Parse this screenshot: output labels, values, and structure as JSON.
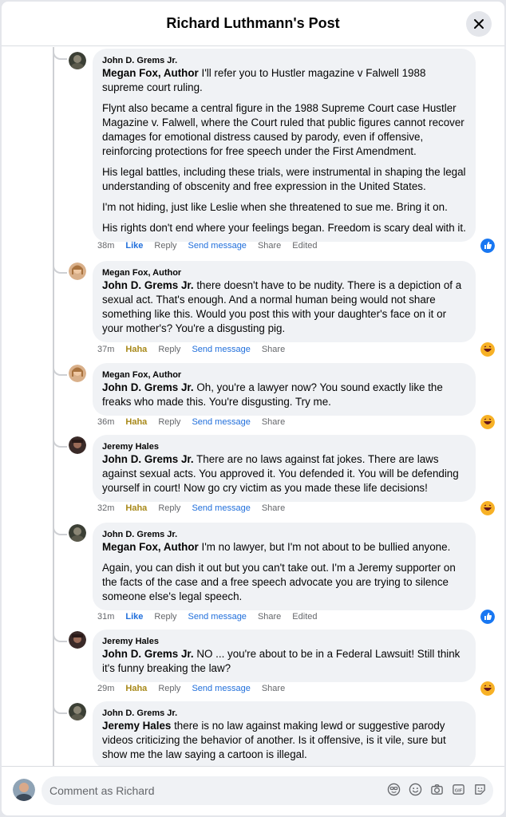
{
  "header": {
    "title": "Richard Luthmann's Post"
  },
  "footer": {
    "placeholder": "Comment as Richard"
  },
  "comments": [
    {
      "author": "John D. Grems Jr.",
      "mention": "Megan Fox, Author",
      "paragraphs": [
        " I'll refer you to Hustler magazine v Falwell 1988 supreme court ruling.",
        "Flynt also became a central figure in the 1988 Supreme Court case Hustler Magazine v. Falwell, where the Court ruled that public figures cannot recover damages for emotional distress caused by parody, even if offensive, reinforcing protections for free speech under the First Amendment.",
        "His legal battles, including these trials, were instrumental in shaping the legal understanding of obscenity and free expression in the United States.",
        "I'm not hiding, just like Leslie when she threatened to sue me. Bring it on.",
        "His rights don't end where your feelings began. Freedom is scary deal with it."
      ],
      "time": "38m",
      "reaction_label": "Like",
      "reply": "Reply",
      "send": "Send message",
      "share": "Share",
      "edited": "Edited",
      "reaction": "like"
    },
    {
      "author": "Megan Fox, Author",
      "mention": "John D. Grems Jr.",
      "paragraphs": [
        " there doesn't have to be nudity. There is a depiction of a sexual act. That's enough. And a normal human being would not share something like this. Would you post this with your daughter's face on it or your mother's? You're a disgusting pig."
      ],
      "time": "37m",
      "reaction_label": "Haha",
      "reply": "Reply",
      "send": "Send message",
      "share": "Share",
      "reaction": "haha"
    },
    {
      "author": "Megan Fox, Author",
      "mention": "John D. Grems Jr.",
      "paragraphs": [
        " Oh, you're a lawyer now? You sound exactly like the freaks who made this. You're disgusting. Try me."
      ],
      "time": "36m",
      "reaction_label": "Haha",
      "reply": "Reply",
      "send": "Send message",
      "share": "Share",
      "reaction": "haha"
    },
    {
      "author": "Jeremy Hales",
      "mention": "John D. Grems Jr.",
      "paragraphs": [
        " There are no laws against fat jokes. There are laws against sexual acts. You approved it. You defended it. You will be defending yourself in court! Now go cry victim as you made these life decisions!"
      ],
      "time": "32m",
      "reaction_label": "Haha",
      "reply": "Reply",
      "send": "Send message",
      "share": "Share",
      "reaction": "haha"
    },
    {
      "author": "John D. Grems Jr.",
      "mention": "Megan Fox, Author",
      "paragraphs": [
        " I'm no lawyer, but I'm not about to be bullied anyone.",
        "Again, you can dish it out but you can't take out. I'm a Jeremy supporter on the facts of the case and a free speech advocate you are trying to silence someone else's legal speech."
      ],
      "time": "31m",
      "reaction_label": "Like",
      "reply": "Reply",
      "send": "Send message",
      "share": "Share",
      "edited": "Edited",
      "reaction": "like"
    },
    {
      "author": "Jeremy Hales",
      "mention": "John D. Grems Jr.",
      "paragraphs": [
        " NO ... you're about to be in a Federal Lawsuit! Still think it's funny breaking the law?"
      ],
      "time": "29m",
      "reaction_label": "Haha",
      "reply": "Reply",
      "send": "Send message",
      "share": "Share",
      "reaction": "haha"
    },
    {
      "author": "John D. Grems Jr.",
      "mention": "Jeremy Hales",
      "paragraphs": [
        " there is no law against making lewd or suggestive parody videos criticizing the behavior of another. Is it offensive, is it vile, sure but show me the law saying a cartoon is illegal."
      ],
      "time": "",
      "reaction": "none"
    }
  ],
  "colors": {
    "like": "#1877f2",
    "haha": "#f7b125",
    "link": "#216fdb"
  },
  "icons": [
    "close-icon",
    "like-reaction-icon",
    "haha-reaction-icon",
    "avatar-icon",
    "custom-sticker-icon",
    "emoji-icon",
    "camera-icon",
    "gif-icon",
    "sticker-icon"
  ]
}
